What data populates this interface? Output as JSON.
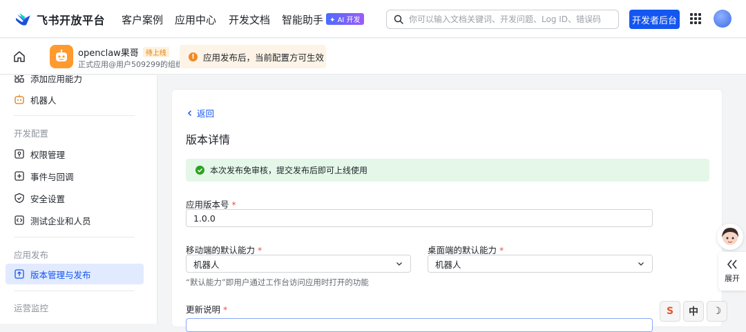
{
  "topbar": {
    "brand": "飞书开放平台",
    "nav": [
      "客户案例",
      "应用中心",
      "开发文档",
      "智能助手"
    ],
    "ai_badge": "✦ AI 开发",
    "search_placeholder": "你可以输入文档关键词、开发问题、Log ID、错误码",
    "dev_console": "开发者后台"
  },
  "appbar": {
    "app_name": "openclaw果哥",
    "app_status": "待上线",
    "app_sub": "正式应用@用户509299的组织",
    "notice": "应用发布后，当前配置方可生效"
  },
  "sidebar": {
    "top_items": [
      {
        "label": "添加应用能力",
        "icon": "add-capability-icon"
      },
      {
        "label": "机器人",
        "icon": "robot-icon"
      }
    ],
    "groups": [
      {
        "title": "开发配置",
        "items": [
          {
            "label": "权限管理",
            "icon": "permission-icon"
          },
          {
            "label": "事件与回调",
            "icon": "event-icon"
          },
          {
            "label": "安全设置",
            "icon": "shield-icon"
          },
          {
            "label": "测试企业和人员",
            "icon": "code-icon"
          }
        ]
      },
      {
        "title": "应用发布",
        "items": [
          {
            "label": "版本管理与发布",
            "icon": "upload-icon",
            "active": true
          }
        ]
      },
      {
        "title": "运营监控",
        "items": []
      }
    ]
  },
  "main": {
    "back": "返回",
    "title": "版本详情",
    "success_msg": "本次发布免审核，提交发布后即可上线使用",
    "version_label": "应用版本号",
    "version_value": "1.0.0",
    "mobile_label": "移动端的默认能力",
    "mobile_value": "机器人",
    "desktop_label": "桌面端的默认能力",
    "desktop_value": "机器人",
    "hint": "“默认能力”即用户通过工作台访问应用时打开的功能",
    "update_label": "更新说明",
    "required_mark": "*"
  },
  "float": {
    "expand": "展开",
    "ime": [
      "S",
      "中",
      "☽"
    ]
  },
  "colors": {
    "primary": "#1456f0",
    "success_bg": "#e4f7e8",
    "notice_bg": "#fdf3e6",
    "required": "#f54a45"
  }
}
